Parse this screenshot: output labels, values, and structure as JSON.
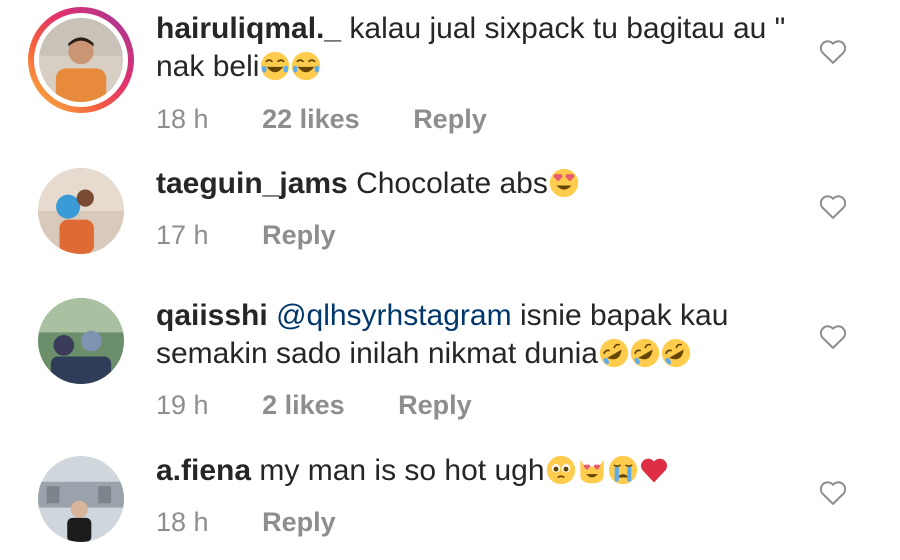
{
  "comments": [
    {
      "username": "hairuliqmal._",
      "text": "kalau jual sixpack tu bagitau au \" nak beli",
      "time": "18 h",
      "likes": "22 likes",
      "reply": "Reply",
      "emojis": [
        "joy-emoji",
        "joy-emoji"
      ]
    },
    {
      "username": "taeguin_jams",
      "text": "Chocolate abs",
      "time": "17 h",
      "reply": "Reply",
      "emojis": [
        "heart-eyes-emoji"
      ]
    },
    {
      "username": "qaiisshi",
      "mention": "@qlhsyrhstagram",
      "text": "isnie bapak kau semakin sado inilah nikmat dunia",
      "time": "19 h",
      "likes": "2 likes",
      "reply": "Reply",
      "emojis": [
        "rofl-emoji",
        "rofl-emoji",
        "rofl-emoji"
      ]
    },
    {
      "username": "a.fiena",
      "text": "my man is so hot ugh",
      "time": "18 h",
      "reply": "Reply",
      "emojis": [
        "pleading-emoji",
        "heart-eyes-cat-emoji",
        "crying-emoji",
        "red-heart-emoji"
      ]
    }
  ],
  "colors": {
    "text": "#262626",
    "meta": "#8e8e8e",
    "mention": "#00376b",
    "heart_outline": "#8e8e8e"
  }
}
